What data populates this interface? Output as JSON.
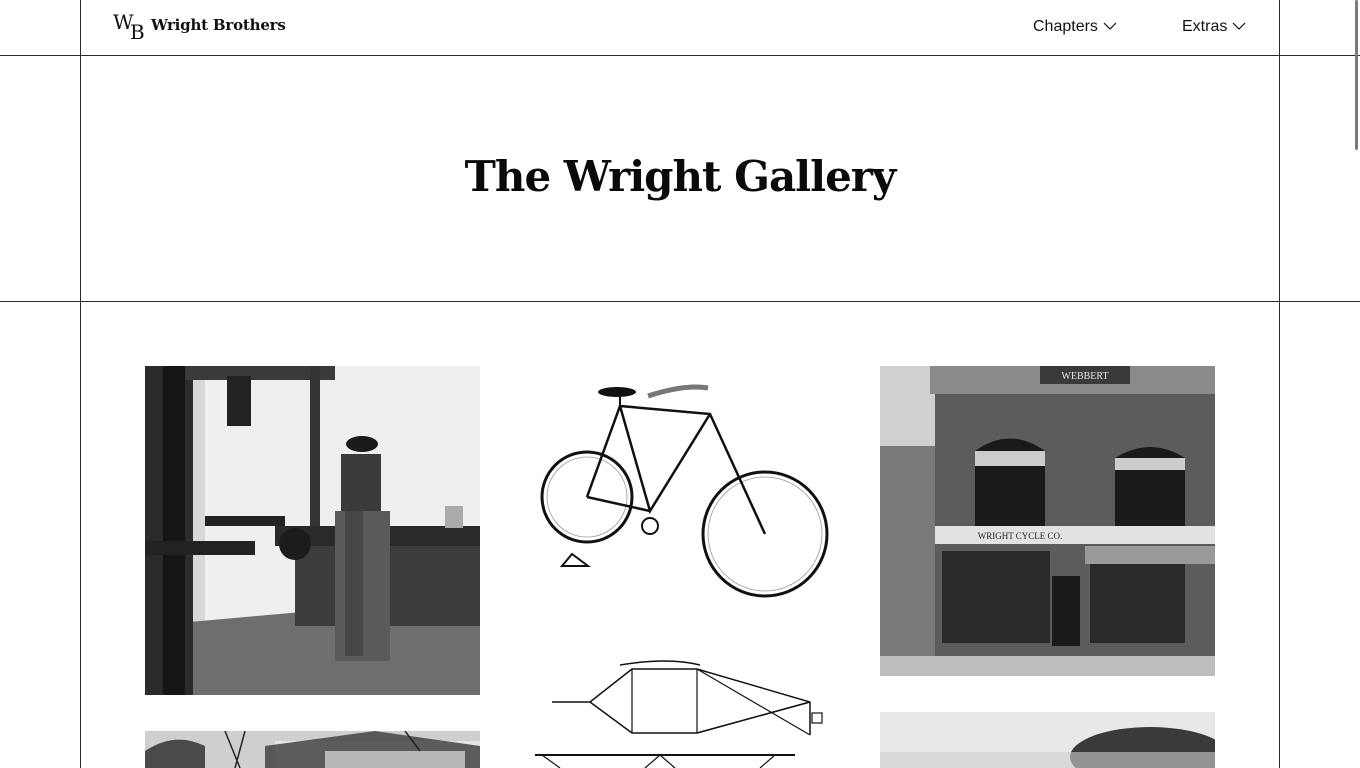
{
  "header": {
    "logo_mark": [
      "W",
      "B"
    ],
    "logo_text": "Wright Brothers",
    "nav": [
      {
        "label": "Chapters",
        "icon": "chevron-down-icon"
      },
      {
        "label": "Extras",
        "icon": "chevron-down-icon"
      }
    ]
  },
  "hero": {
    "title": "The Wright Gallery"
  },
  "gallery": {
    "storefront_signs": [
      "WRIGHT CYCLE CO.",
      "WEBBERT"
    ],
    "photos": [
      {
        "subject": "man working at machine lathe in workshop"
      },
      {
        "subject": "antique safety bicycle"
      },
      {
        "subject": "Wright Cycle Co. brick storefront"
      },
      {
        "subject": "aircraft structural diagram"
      },
      {
        "subject": "house with bare trees"
      },
      {
        "subject": "outdoor photograph"
      }
    ]
  },
  "colors": {
    "background": "#ffffff",
    "lines": "#2a2a2a",
    "text": "#111111"
  }
}
